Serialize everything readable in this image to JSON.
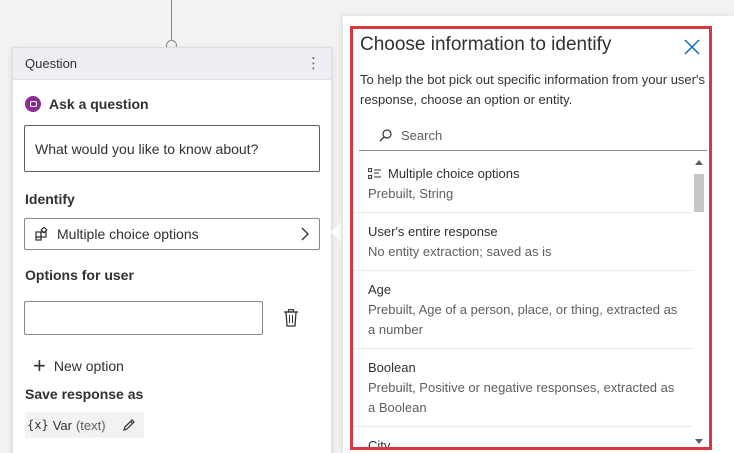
{
  "question_card": {
    "header": "Question",
    "more_icon": "more-vertical-icon",
    "ask_label": "Ask a question",
    "question_text": "What would you like to know about?",
    "identify_label": "Identify",
    "identify_value": "Multiple choice options",
    "options_label": "Options for user",
    "option_value": "",
    "new_option_label": "New option",
    "save_label": "Save response as",
    "var_icon": "{x}",
    "var_name": "Var",
    "var_type": "(text)"
  },
  "panel": {
    "title": "Choose information to identify",
    "description": "To help the bot pick out specific information from your user's response, choose an option or entity.",
    "search_placeholder": "Search",
    "items": [
      {
        "title": "Multiple choice options",
        "subtitle": "Prebuilt, String",
        "icon": "list-options-icon"
      },
      {
        "title": "User's entire response",
        "subtitle": "No entity extraction; saved as is"
      },
      {
        "title": "Age",
        "subtitle": "Prebuilt, Age of a person, place, or thing, extracted as a number"
      },
      {
        "title": "Boolean",
        "subtitle": "Prebuilt, Positive or negative responses, extracted as a Boolean"
      },
      {
        "title": "City",
        "subtitle": ""
      }
    ]
  },
  "colors": {
    "highlight_border": "#d9383f",
    "accent_purple": "#8a2d8f",
    "header_bg": "#f0edf4"
  }
}
